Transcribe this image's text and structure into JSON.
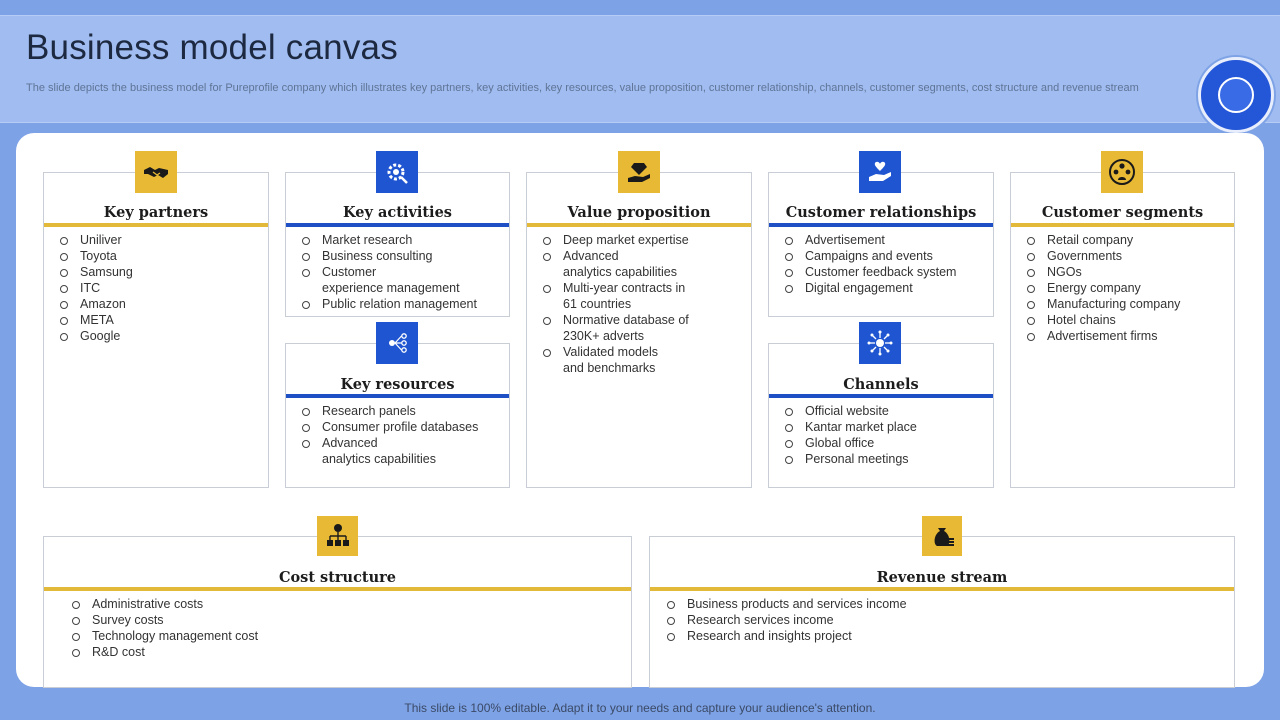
{
  "header": {
    "title": "Business model canvas",
    "subtitle": "The slide depicts the business model for Pureprofile company which illustrates key partners, key activities, key resources, value proposition, customer relationship, channels, customer segments, cost structure and revenue stream"
  },
  "colors": {
    "gold": "#e3b93a",
    "blue": "#1f4fc4",
    "background": "#7da2e6"
  },
  "sections": {
    "key_partners": {
      "icon": "handshake-icon",
      "title": "Key partners",
      "items": [
        "Uniliver",
        "Toyota",
        "Samsung",
        "ITC",
        "Amazon",
        "META",
        "Google"
      ]
    },
    "key_activities": {
      "icon": "gear-tools-icon",
      "title": "Key activities",
      "items": [
        "Market research",
        "Business consulting",
        "Customer\nexperience management",
        "Public relation management"
      ]
    },
    "key_resources": {
      "icon": "network-icon",
      "title": "Key resources",
      "items": [
        "Research panels",
        "Consumer profile databases",
        "Advanced\nanalytics capabilities"
      ]
    },
    "value_proposition": {
      "icon": "diamond-hand-icon",
      "title": "Value proposition",
      "items": [
        "Deep market expertise",
        "Advanced\nanalytics capabilities",
        "Multi-year contracts in\n61 countries",
        "Normative database of\n230K+ adverts",
        "Validated models\nand benchmarks"
      ]
    },
    "customer_relationships": {
      "icon": "heart-hand-icon",
      "title": "Customer relationships",
      "items": [
        "Advertisement",
        "Campaigns and events",
        "Customer feedback system",
        "Digital engagement"
      ]
    },
    "channels": {
      "icon": "hub-icon",
      "title": "Channels",
      "items": [
        "Official website",
        "Kantar market place",
        "Global office",
        "Personal meetings"
      ]
    },
    "customer_segments": {
      "icon": "group-icon",
      "title": "Customer segments",
      "items": [
        "Retail company",
        "Governments",
        "NGOs",
        "Energy company",
        "Manufacturing company",
        "Hotel chains",
        "Advertisement firms"
      ]
    },
    "cost_structure": {
      "icon": "money-hierarchy-icon",
      "title": "Cost structure",
      "items": [
        "Administrative costs",
        "Survey costs",
        "Technology management cost",
        "R&D cost"
      ]
    },
    "revenue_stream": {
      "icon": "money-bag-icon",
      "title": "Revenue stream",
      "items": [
        "Business products and  services income",
        "Research services income",
        "Research and insights project"
      ]
    }
  },
  "footer": {
    "text": "This slide is 100% editable. Adapt it to your needs and capture your audience's attention."
  }
}
